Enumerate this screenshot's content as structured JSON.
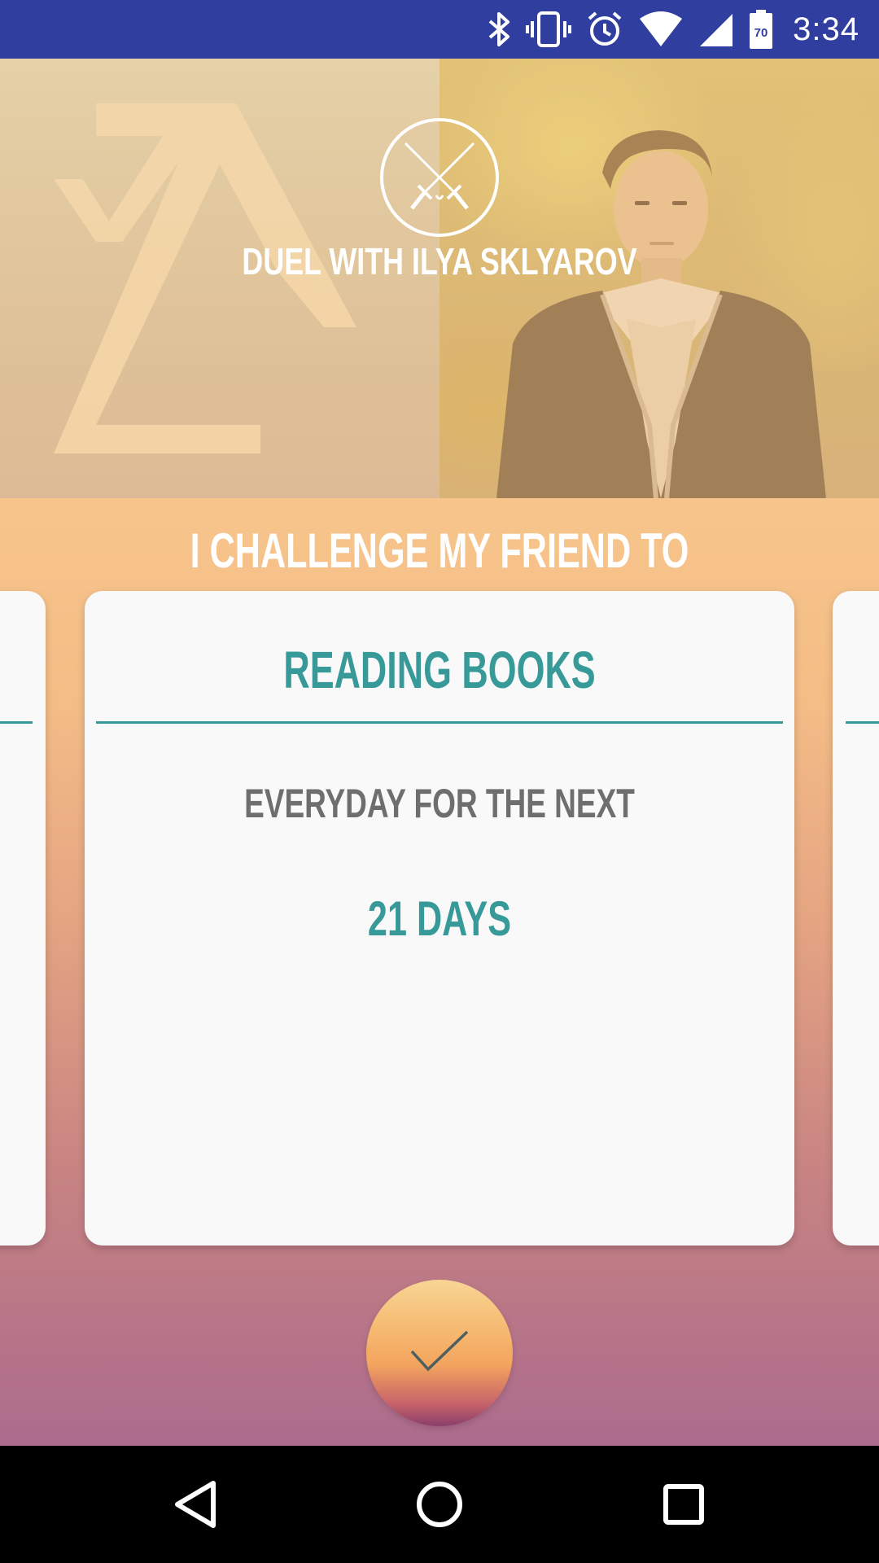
{
  "status_bar": {
    "time": "3:34",
    "battery_level": "70",
    "icons": [
      "bluetooth-icon",
      "vibrate-icon",
      "alarm-icon",
      "wifi-icon",
      "cell-signal-icon",
      "battery-icon"
    ]
  },
  "header": {
    "title": "DUEL WITH ILYA SKLYAROV",
    "emblem": "crossed-swords-icon",
    "logo": "za-logo",
    "photo": "person-photo"
  },
  "challenge": {
    "heading": "I CHALLENGE MY FRIEND TO",
    "card": {
      "activity": "READING BOOKS",
      "frequency": "EVERYDAY FOR THE NEXT",
      "duration": "21 DAYS"
    }
  },
  "confirm": {
    "icon": "checkmark-icon"
  },
  "nav_bar": {
    "buttons": [
      "back-icon",
      "home-icon",
      "recents-icon"
    ]
  },
  "colors": {
    "status_bar": "#303f9f",
    "accent": "#389a98",
    "card": "#f9f9f9",
    "gradient_top": "#f7c58c",
    "gradient_bottom": "#ac6b8d"
  }
}
